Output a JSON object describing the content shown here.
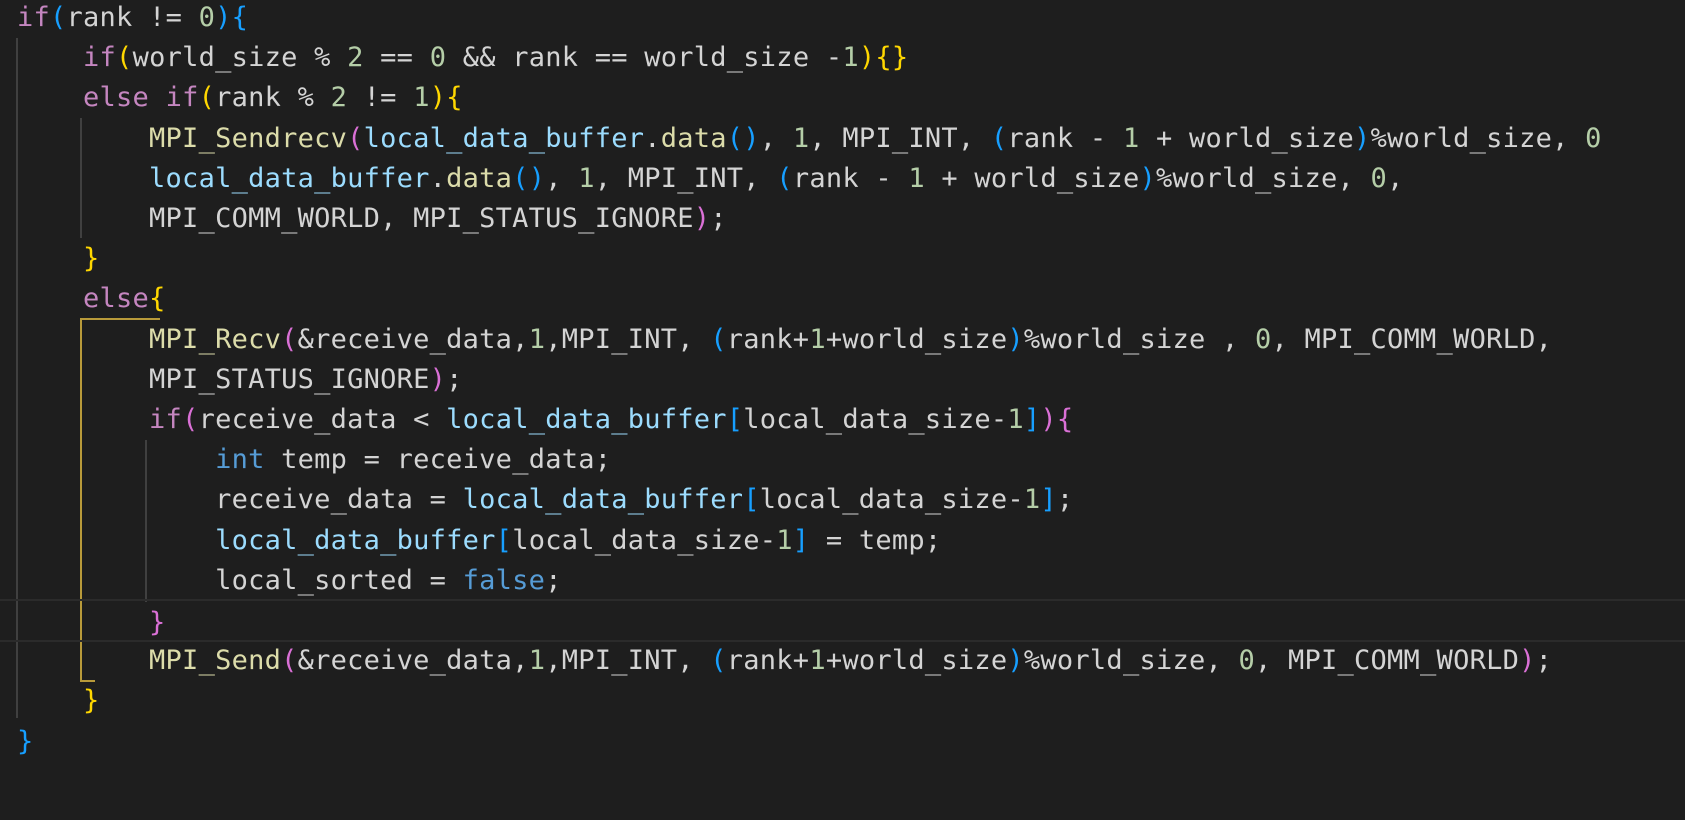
{
  "editor": {
    "theme_colors": {
      "background": "#1e1e1e",
      "keyword": "#c586c0",
      "function": "#dcdcaa",
      "type": "#569cd6",
      "variable": "#9cdcfe",
      "number": "#b5cea8",
      "text": "#d4d4d4",
      "bracket_level1": "#ffd700",
      "bracket_level2": "#da70d6",
      "bracket_level3": "#179fff",
      "active_guide": "#b89a3a"
    },
    "lines": [
      [
        [
          "kw",
          "if"
        ],
        [
          "br3",
          "("
        ],
        [
          "txt",
          "rank != "
        ],
        [
          "num",
          "0"
        ],
        [
          "br3",
          ")"
        ],
        [
          "br3",
          "{"
        ]
      ],
      [
        [
          "txt",
          "    "
        ],
        [
          "kw",
          "if"
        ],
        [
          "br1",
          "("
        ],
        [
          "txt",
          "world_size % "
        ],
        [
          "num",
          "2"
        ],
        [
          "txt",
          " == "
        ],
        [
          "num",
          "0"
        ],
        [
          "txt",
          " && rank == world_size -"
        ],
        [
          "num",
          "1"
        ],
        [
          "br1",
          ")"
        ],
        [
          "br1",
          "{}"
        ]
      ],
      [
        [
          "txt",
          "    "
        ],
        [
          "kw",
          "else"
        ],
        [
          "txt",
          " "
        ],
        [
          "kw",
          "if"
        ],
        [
          "br1",
          "("
        ],
        [
          "txt",
          "rank % "
        ],
        [
          "num",
          "2"
        ],
        [
          "txt",
          " != "
        ],
        [
          "num",
          "1"
        ],
        [
          "br1",
          ")"
        ],
        [
          "br1",
          "{"
        ]
      ],
      [
        [
          "txt",
          "        "
        ],
        [
          "fn",
          "MPI_Sendrecv"
        ],
        [
          "br2",
          "("
        ],
        [
          "var",
          "local_data_buffer"
        ],
        [
          "txt",
          "."
        ],
        [
          "fn",
          "data"
        ],
        [
          "br3",
          "()"
        ],
        [
          "txt",
          ", "
        ],
        [
          "num",
          "1"
        ],
        [
          "txt",
          ", MPI_INT, "
        ],
        [
          "br3",
          "("
        ],
        [
          "txt",
          "rank - "
        ],
        [
          "num",
          "1"
        ],
        [
          "txt",
          " + world_size"
        ],
        [
          "br3",
          ")"
        ],
        [
          "txt",
          "%world_size, "
        ],
        [
          "num",
          "0"
        ]
      ],
      [
        [
          "txt",
          "        "
        ],
        [
          "var",
          "local_data_buffer"
        ],
        [
          "txt",
          "."
        ],
        [
          "fn",
          "data"
        ],
        [
          "br3",
          "()"
        ],
        [
          "txt",
          ", "
        ],
        [
          "num",
          "1"
        ],
        [
          "txt",
          ", MPI_INT, "
        ],
        [
          "br3",
          "("
        ],
        [
          "txt",
          "rank - "
        ],
        [
          "num",
          "1"
        ],
        [
          "txt",
          " + world_size"
        ],
        [
          "br3",
          ")"
        ],
        [
          "txt",
          "%world_size, "
        ],
        [
          "num",
          "0"
        ],
        [
          "txt",
          ","
        ]
      ],
      [
        [
          "txt",
          "        MPI_COMM_WORLD, MPI_STATUS_IGNORE"
        ],
        [
          "br2",
          ")"
        ],
        [
          "txt",
          ";"
        ]
      ],
      [
        [
          "txt",
          "    "
        ],
        [
          "br1",
          "}"
        ]
      ],
      [
        [
          "txt",
          "    "
        ],
        [
          "kw",
          "else"
        ],
        [
          "br1",
          "{"
        ]
      ],
      [
        [
          "txt",
          "        "
        ],
        [
          "fn",
          "MPI_Recv"
        ],
        [
          "br2",
          "("
        ],
        [
          "txt",
          "&receive_data,"
        ],
        [
          "num",
          "1"
        ],
        [
          "txt",
          ",MPI_INT, "
        ],
        [
          "br3",
          "("
        ],
        [
          "txt",
          "rank+"
        ],
        [
          "num",
          "1"
        ],
        [
          "txt",
          "+world_size"
        ],
        [
          "br3",
          ")"
        ],
        [
          "txt",
          "%world_size , "
        ],
        [
          "num",
          "0"
        ],
        [
          "txt",
          ", MPI_COMM_WORLD,"
        ]
      ],
      [
        [
          "txt",
          "        MPI_STATUS_IGNORE"
        ],
        [
          "br2",
          ")"
        ],
        [
          "txt",
          ";"
        ]
      ],
      [
        [
          "txt",
          "        "
        ],
        [
          "kw",
          "if"
        ],
        [
          "br2",
          "("
        ],
        [
          "txt",
          "receive_data < "
        ],
        [
          "var",
          "local_data_buffer"
        ],
        [
          "br3",
          "["
        ],
        [
          "txt",
          "local_data_size-"
        ],
        [
          "num",
          "1"
        ],
        [
          "br3",
          "]"
        ],
        [
          "br2",
          ")"
        ],
        [
          "br2",
          "{"
        ]
      ],
      [
        [
          "txt",
          "            "
        ],
        [
          "ty",
          "int"
        ],
        [
          "txt",
          " temp = receive_data;"
        ]
      ],
      [
        [
          "txt",
          "            receive_data = "
        ],
        [
          "var",
          "local_data_buffer"
        ],
        [
          "br3",
          "["
        ],
        [
          "txt",
          "local_data_size-"
        ],
        [
          "num",
          "1"
        ],
        [
          "br3",
          "]"
        ],
        [
          "txt",
          ";"
        ]
      ],
      [
        [
          "txt",
          "            "
        ],
        [
          "var",
          "local_data_buffer"
        ],
        [
          "br3",
          "["
        ],
        [
          "txt",
          "local_data_size-"
        ],
        [
          "num",
          "1"
        ],
        [
          "br3",
          "]"
        ],
        [
          "txt",
          " = temp;"
        ]
      ],
      [
        [
          "txt",
          "            local_sorted = "
        ],
        [
          "ty",
          "false"
        ],
        [
          "txt",
          ";"
        ]
      ],
      [
        [
          "txt",
          "        "
        ],
        [
          "br2",
          "}"
        ]
      ],
      [
        [
          "txt",
          "        "
        ],
        [
          "fn",
          "MPI_Send"
        ],
        [
          "br2",
          "("
        ],
        [
          "txt",
          "&receive_data,"
        ],
        [
          "num",
          "1"
        ],
        [
          "txt",
          ",MPI_INT, "
        ],
        [
          "br3",
          "("
        ],
        [
          "txt",
          "rank+"
        ],
        [
          "num",
          "1"
        ],
        [
          "txt",
          "+world_size"
        ],
        [
          "br3",
          ")"
        ],
        [
          "txt",
          "%world_size, "
        ],
        [
          "num",
          "0"
        ],
        [
          "txt",
          ", MPI_COMM_WORLD"
        ],
        [
          "br2",
          ")"
        ],
        [
          "txt",
          ";"
        ]
      ],
      [
        [
          "txt",
          "    "
        ],
        [
          "br1",
          "}"
        ]
      ],
      [
        [
          "br3",
          "}"
        ]
      ]
    ]
  }
}
